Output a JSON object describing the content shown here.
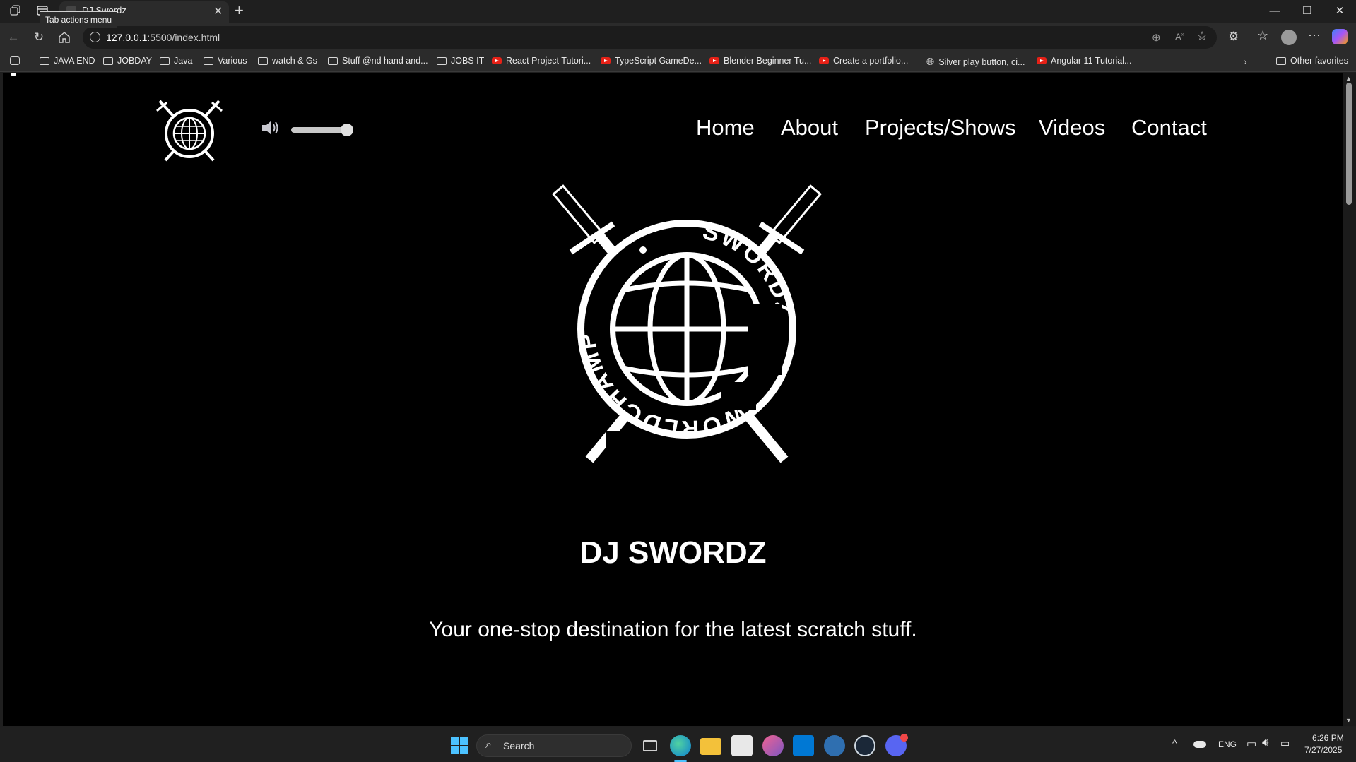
{
  "browser": {
    "tab_title": "DJ Swordz",
    "tooltip": "Tab actions menu",
    "url_host": "127.0.0.1",
    "url_rest": ":5500/index.html",
    "favorites": [
      {
        "label": "JAVA END",
        "type": "folder"
      },
      {
        "label": "JOBDAY",
        "type": "folder"
      },
      {
        "label": "Java",
        "type": "folder"
      },
      {
        "label": "Various",
        "type": "folder"
      },
      {
        "label": "watch & Gs",
        "type": "folder"
      },
      {
        "label": "Stuff @nd hand and...",
        "type": "folder"
      },
      {
        "label": "JOBS IT",
        "type": "folder"
      },
      {
        "label": "React Project Tutori...",
        "type": "youtube"
      },
      {
        "label": "TypeScript GameDe...",
        "type": "youtube"
      },
      {
        "label": "Blender Beginner Tu...",
        "type": "youtube"
      },
      {
        "label": "Create a portfolio...",
        "type": "youtube"
      },
      {
        "label": "Silver play button, ci...",
        "type": "globe"
      },
      {
        "label": "Angular 11 Tutorial...",
        "type": "youtube"
      }
    ],
    "other_favorites": "Other favorites"
  },
  "site": {
    "nav": [
      "Home",
      "About",
      "Projects/Shows",
      "Videos",
      "Contact"
    ],
    "volume": 1.0,
    "logo_text": [
      "SWORDZ",
      "CHAMP",
      "WORLD"
    ],
    "hero_title": "DJ SWORDZ",
    "hero_subtitle": "Your one-stop destination for the latest scratch stuff."
  },
  "taskbar": {
    "search_label": "Search",
    "language": "ENG",
    "time": "6:26 PM",
    "date": "7/27/2025"
  }
}
